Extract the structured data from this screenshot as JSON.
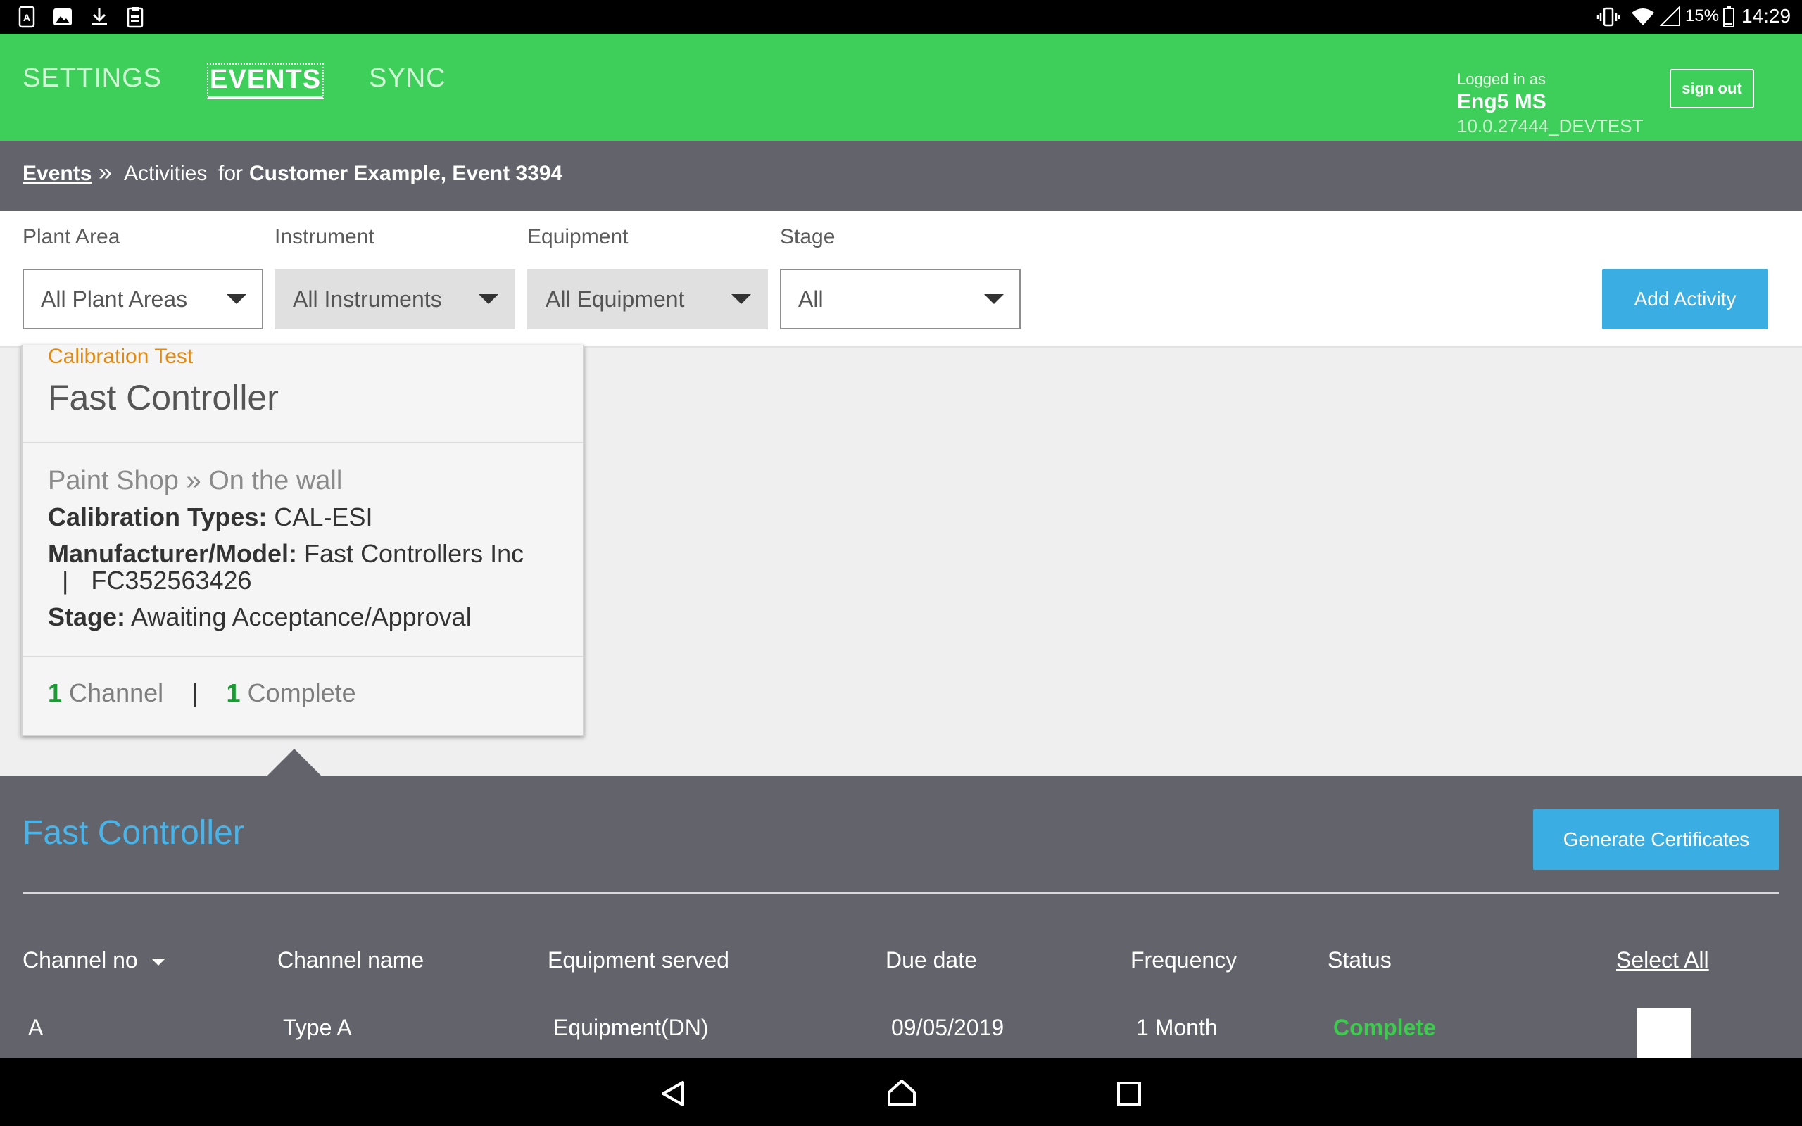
{
  "status_bar": {
    "battery": "15%",
    "time": "14:29",
    "icons": [
      "a-app-icon",
      "image-icon",
      "download-icon",
      "clipboard-icon",
      "vibrate-icon",
      "wifi-icon",
      "signal-icon",
      "battery-icon"
    ]
  },
  "nav": {
    "tabs": [
      {
        "label": "SETTINGS",
        "active": false
      },
      {
        "label": "EVENTS",
        "active": true
      },
      {
        "label": "SYNC",
        "active": false
      }
    ],
    "logged_in_label": "Logged in as",
    "user_name": "Eng5 MS",
    "version": "10.0.27444_DEVTEST",
    "sign_out": "sign out"
  },
  "breadcrumb": {
    "root": "Events",
    "separator": "»",
    "current": "Activities",
    "for_label": "for",
    "context": "Customer Example, Event 3394"
  },
  "filters": [
    {
      "label": "Plant Area",
      "value": "All Plant Areas",
      "enabled": true
    },
    {
      "label": "Instrument",
      "value": "All Instruments",
      "enabled": false
    },
    {
      "label": "Equipment",
      "value": "All Equipment",
      "enabled": false
    },
    {
      "label": "Stage",
      "value": "All",
      "enabled": true
    }
  ],
  "add_activity": "Add Activity",
  "card": {
    "type": "Calibration Test",
    "title": "Fast Controller",
    "location_area": "Paint Shop",
    "location_sep": "»",
    "location_place": "On the wall",
    "cal_types_label": "Calibration Types:",
    "cal_types_value": "CAL-ESI",
    "mfr_label": "Manufacturer/Model:",
    "mfr_value": "Fast Controllers Inc",
    "model_sep": "|",
    "model_value": "FC352563426",
    "stage_label": "Stage:",
    "stage_value": "Awaiting Acceptance/Approval",
    "channel_count": "1",
    "channel_label": "Channel",
    "count_sep": "|",
    "complete_count": "1",
    "complete_label": "Complete"
  },
  "detail": {
    "title": "Fast Controller",
    "generate": "Generate Certificates",
    "columns": {
      "channel_no": "Channel no",
      "channel_name": "Channel name",
      "equipment_served": "Equipment served",
      "due_date": "Due date",
      "frequency": "Frequency",
      "status": "Status",
      "select_all": "Select All"
    },
    "rows": [
      {
        "channel_no": "A",
        "channel_name": "Type A",
        "equipment_served": "Equipment(DN)",
        "due_date": "09/05/2019",
        "frequency": "1 Month",
        "status": "Complete",
        "selected": false
      }
    ]
  },
  "colors": {
    "nav_green": "#3ecf5a",
    "header_grey": "#63646b",
    "accent_blue": "#3aaee3",
    "type_orange": "#e08a16",
    "status_green": "#3ec94f",
    "count_green": "#1c9a35"
  }
}
